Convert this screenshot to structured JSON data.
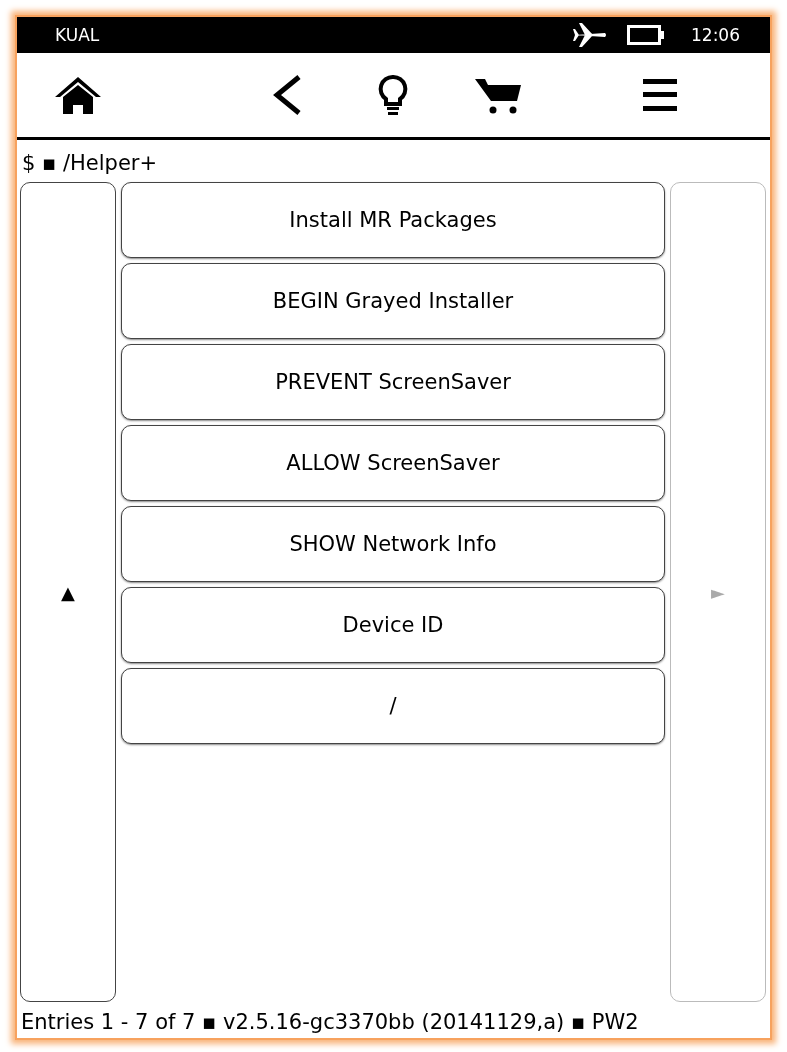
{
  "status_bar": {
    "carrier": "KUAL",
    "airplane_mode": true,
    "time": "12:06"
  },
  "toolbar": {
    "buttons": [
      {
        "kind": "home"
      },
      {
        "kind": "back"
      },
      {
        "kind": "light"
      },
      {
        "kind": "cart"
      },
      {
        "kind": "menu"
      }
    ]
  },
  "path": "$ ▪ /Helper+",
  "prev_page": {
    "label": "▲",
    "disabled": false
  },
  "next_page": {
    "label": "►",
    "disabled": true
  },
  "entries": [
    {
      "label": "Install MR Packages"
    },
    {
      "label": "BEGIN Grayed Installer"
    },
    {
      "label": "PREVENT ScreenSaver"
    },
    {
      "label": "ALLOW ScreenSaver"
    },
    {
      "label": "SHOW Network Info"
    },
    {
      "label": "Device ID"
    },
    {
      "label": "/"
    }
  ],
  "footer": "Entries 1 - 7 of 7 ▪ v2.5.16-gc3370bb (20141129,a) ▪ PW2"
}
